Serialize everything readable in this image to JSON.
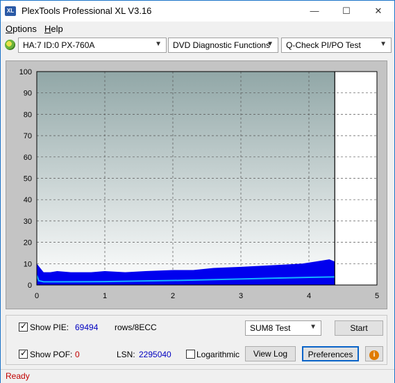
{
  "app": {
    "title": "PlexTools Professional XL V3.16",
    "icon_text": "XL"
  },
  "window_controls": {
    "minimize": "—",
    "maximize": "☐",
    "close": "✕"
  },
  "menu": {
    "options": "Options",
    "help": "Help"
  },
  "toolbar": {
    "drive": "HA:7 ID:0  PX-760A",
    "function": "DVD Diagnostic Functions",
    "test": "Q-Check PI/PO Test"
  },
  "chart_data": {
    "type": "bar",
    "x_ticks": [
      "0",
      "1",
      "2",
      "3",
      "4",
      "5"
    ],
    "y_ticks": [
      "0",
      "10",
      "20",
      "30",
      "40",
      "50",
      "60",
      "70",
      "80",
      "90",
      "100"
    ],
    "xlim": [
      0,
      5
    ],
    "ylim": [
      0,
      100
    ],
    "data_end_x": 4.38,
    "grid": true,
    "colors": {
      "pie": "#0000ee",
      "sum8_line": "#14b4ff",
      "plot_top": "#91a7a7",
      "plot_bottom": "#ffffff"
    },
    "pie_envelope": {
      "x": [
        0.0,
        0.05,
        0.1,
        0.2,
        0.3,
        0.5,
        0.8,
        1.0,
        1.3,
        1.6,
        2.0,
        2.3,
        2.6,
        3.0,
        3.3,
        3.6,
        3.9,
        4.1,
        4.3,
        4.38
      ],
      "y": [
        10.0,
        8.0,
        6.0,
        6.0,
        6.5,
        6.0,
        6.0,
        6.5,
        6.0,
        6.5,
        7.0,
        7.0,
        8.0,
        8.5,
        9.0,
        9.5,
        10.0,
        11.0,
        12.0,
        11.0
      ]
    },
    "sum8_line": {
      "x": [
        0.0,
        0.03,
        0.1,
        0.3,
        1.0,
        2.0,
        3.0,
        4.0,
        4.38
      ],
      "y": [
        4.5,
        2.0,
        1.5,
        1.5,
        1.6,
        2.1,
        2.8,
        3.6,
        3.8
      ]
    }
  },
  "controls": {
    "show_pie_label": "Show PIE:",
    "pie_value": "69494",
    "rows_label": "rows/8ECC",
    "show_pof_label": "Show POF:",
    "pof_value": "0",
    "lsn_label": "LSN:",
    "lsn_value": "2295040",
    "logarithmic_label": "Logarithmic",
    "test_select": "SUM8 Test",
    "start_button": "Start",
    "view_log_button": "View Log",
    "preferences_button": "Preferences",
    "info_icon": "i"
  },
  "status": {
    "text": "Ready"
  }
}
